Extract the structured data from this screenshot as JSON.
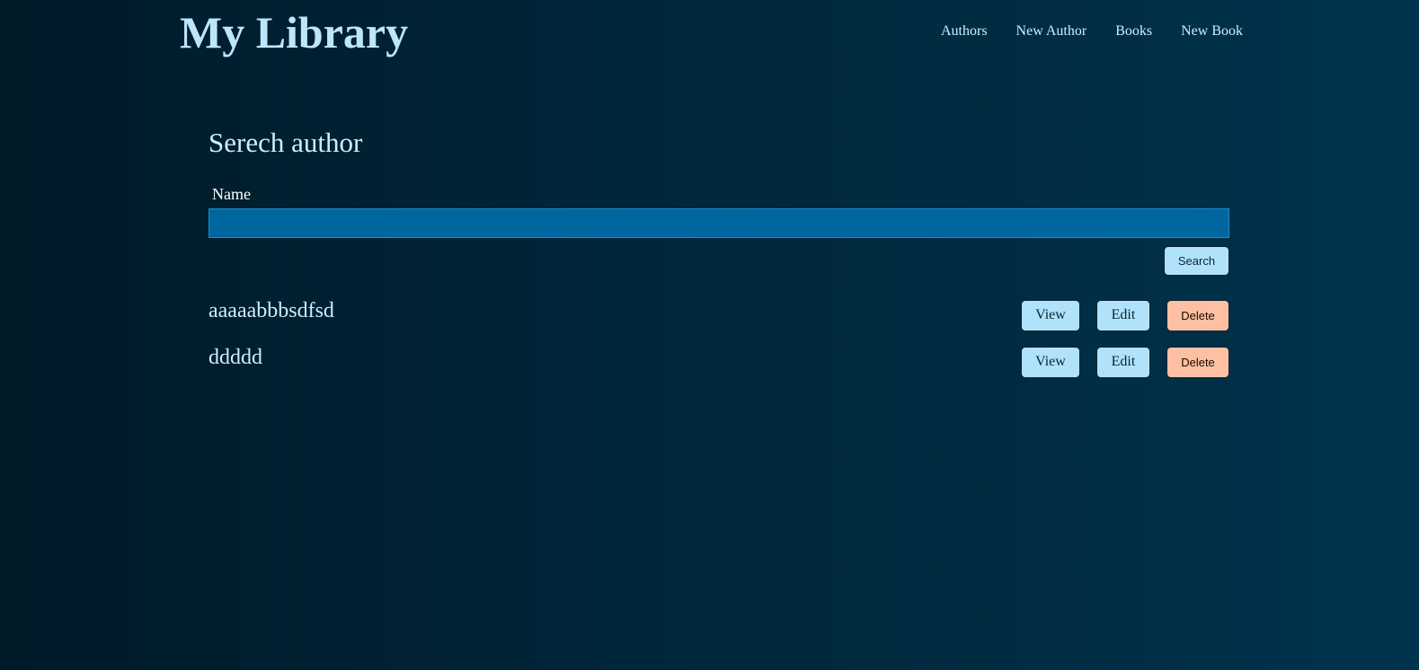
{
  "header": {
    "brand": "My Library",
    "nav": [
      {
        "label": "Authors"
      },
      {
        "label": "New Author"
      },
      {
        "label": "Books"
      },
      {
        "label": "New Book"
      }
    ]
  },
  "search": {
    "title": "Serech author",
    "name_label": "Name",
    "name_value": "",
    "button_label": "Search"
  },
  "authors": [
    {
      "name": "aaaaabbbsdfsd",
      "view_label": "View",
      "edit_label": "Edit",
      "delete_label": "Delete"
    },
    {
      "name": "ddddd",
      "view_label": "View",
      "edit_label": "Edit",
      "delete_label": "Delete"
    }
  ],
  "colors": {
    "background_start": "#001a28",
    "background_end": "#00334d",
    "input_background": "#00679e",
    "button_primary": "#b0e3fb",
    "button_danger": "#fdc0a3",
    "text": "#cdeeff"
  }
}
